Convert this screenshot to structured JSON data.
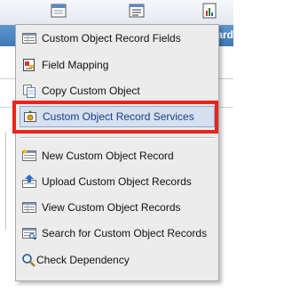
{
  "header": {
    "nav_text": "hboard"
  },
  "menu": {
    "items": [
      {
        "label": "Custom Object Record Fields",
        "icon": "fields-list-icon"
      },
      {
        "label": "Field Mapping",
        "icon": "field-mapping-icon"
      },
      {
        "label": "Copy Custom Object",
        "icon": "copy-icon"
      },
      {
        "label": "Custom Object Record Services",
        "icon": "services-icon",
        "highlighted": true
      },
      {
        "label": "New Custom Object Record",
        "icon": "new-record-icon"
      },
      {
        "label": "Upload Custom Object Records",
        "icon": "upload-icon"
      },
      {
        "label": "View Custom Object Records",
        "icon": "view-records-icon"
      },
      {
        "label": "Search for Custom Object Records",
        "icon": "search-records-icon"
      },
      {
        "label": "Check Dependency",
        "icon": "magnifier-icon"
      }
    ]
  },
  "colors": {
    "highlight_outline": "#e8241c",
    "nav_band": "#4a84c0"
  }
}
